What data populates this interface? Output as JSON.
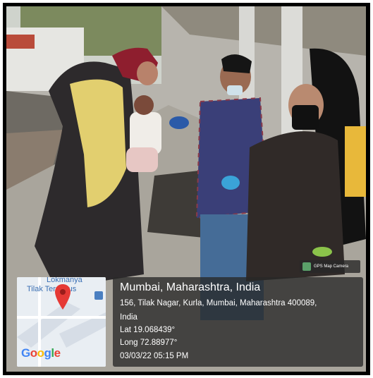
{
  "colors": {
    "overlay_bg": "#2a2a2a",
    "pin": "#e53935",
    "map_bg": "#e9eef3",
    "label_blue": "#3a6fb3"
  },
  "map": {
    "place_label_line1": "Lokmanya",
    "place_label_line2": "Tilak Terminus",
    "logo": "Google",
    "pin_icon": "map-pin-icon"
  },
  "camera": {
    "badge_text": "GPS Map Camera",
    "icon": "gps-camera-icon"
  },
  "location": {
    "title": "Mumbai, Maharashtra, India",
    "address": "156, Tilak Nagar, Kurla, Mumbai, Maharashtra 400089,",
    "country": "India",
    "lat": "Lat 19.068439°",
    "long": "Long 72.88977°",
    "datetime": "03/03/22 05:15 PM"
  }
}
